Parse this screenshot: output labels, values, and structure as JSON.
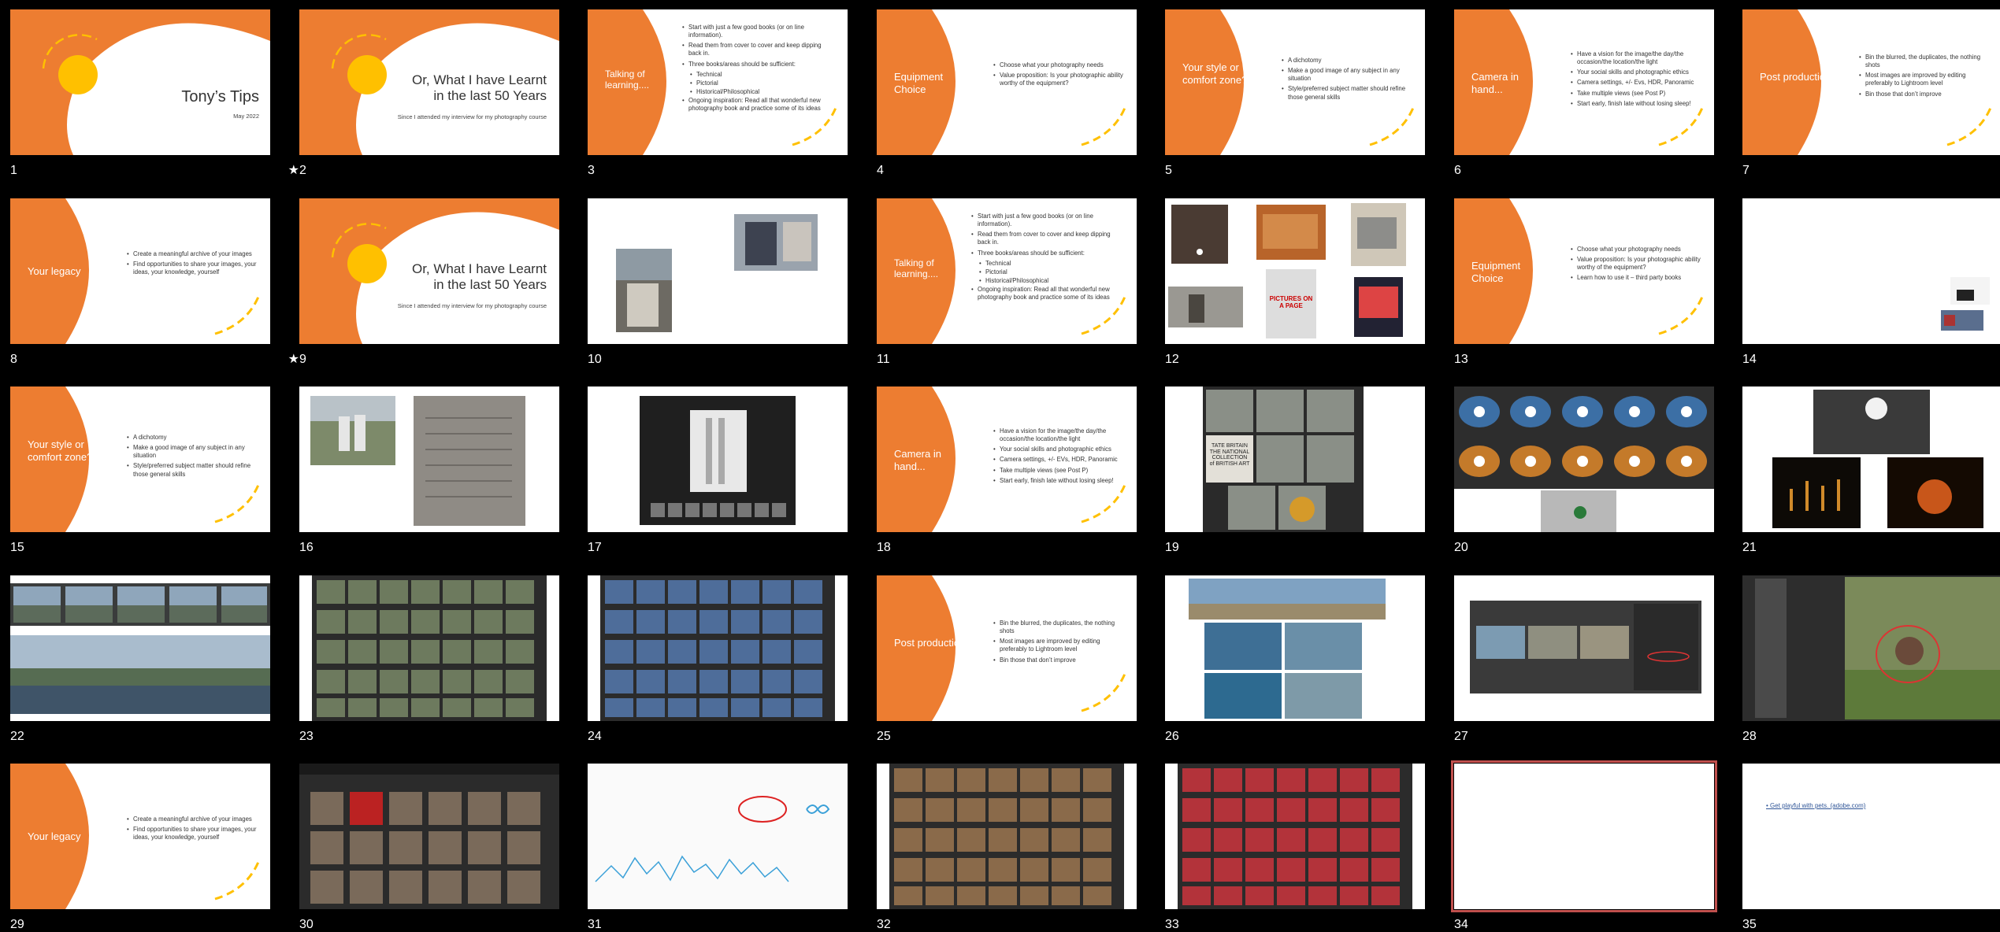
{
  "colors": {
    "orange": "#ed7d31",
    "sun": "#ffc000",
    "selection": "#c0504d"
  },
  "slides": {
    "s1": {
      "number": "1",
      "title": "Tony’s Tips",
      "subtitle": "May 2022"
    },
    "s2": {
      "number": "2",
      "title_line1": "Or, What I have Learnt",
      "title_line2": "in the last 50 Years",
      "subtitle": "Since I attended my interview for my photography course",
      "badge": "★"
    },
    "s3": {
      "number": "3",
      "bullets": [
        "Start with just a few good books (or on line information).",
        "Read them from cover to cover and keep dipping back in.",
        "Three books/areas should be sufficient:"
      ],
      "subbullets": [
        "Technical",
        "Pictorial",
        "Historical/Philosophical"
      ],
      "last": "Ongoing inspiration: Read all that wonderful new photography book and practice some of its ideas",
      "heading": "Talking of learning...."
    },
    "s4": {
      "number": "4",
      "heading": "Equipment Choice",
      "bullets": [
        "Choose what your photography needs",
        "Value proposition: Is your photographic ability worthy of the equipment?"
      ]
    },
    "s5": {
      "number": "5",
      "heading": "Your style or comfort zone?",
      "bullets": [
        "A dichotomy",
        "Make a good image of any subject in any situation",
        "Style/preferred subject matter should refine those general skills"
      ]
    },
    "s6": {
      "number": "6",
      "heading": "Camera in hand...",
      "bullets": [
        "Have a vision for the image/the day/the occasion/the location/the light",
        "Your social skills and photographic ethics",
        "Camera settings, +/- Evs, HDR, Panoramic",
        "Take multiple views (see Post P)",
        "Start early, finish late without losing sleep!"
      ]
    },
    "s7": {
      "number": "7",
      "heading": "Post production",
      "bullets": [
        "Bin the blurred, the duplicates, the nothing shots",
        "Most images are improved by editing preferably to Lightroom level",
        "Bin those that don’t improve"
      ]
    },
    "s8": {
      "number": "8",
      "heading": "Your legacy",
      "bullets": [
        "Create a meaningful archive of your images",
        "Find opportunities to share your images, your ideas, your knowledge, yourself"
      ]
    },
    "s9": {
      "number": "9",
      "title_line1": "Or, What I have Learnt",
      "title_line2": "in the last 50 Years",
      "subtitle": "Since I attended my interview for my photography course",
      "badge": "★"
    },
    "s10": {
      "number": "10"
    },
    "s11": {
      "number": "11",
      "heading": "Talking of learning....",
      "bullets": [
        "Start with just a few good books (or on line information).",
        "Read them from cover to cover and keep dipping back in.",
        "Three books/areas should be sufficient:"
      ],
      "subbullets": [
        "Technical",
        "Pictorial",
        "Historical/Philosophical"
      ],
      "last": "Ongoing inspiration: Read all that wonderful new photography book and practice some of its ideas"
    },
    "s12": {
      "number": "12",
      "book_text": "PICTURES ON A PAGE"
    },
    "s13": {
      "number": "13",
      "heading": "Equipment Choice",
      "bullets": [
        "Choose what your photography needs",
        "Value proposition: Is your photographic ability worthy of the equipment?",
        "Learn how to use it – third party books"
      ]
    },
    "s14": {
      "number": "14"
    },
    "s15": {
      "number": "15",
      "heading": "Your style or comfort zone?",
      "bullets": [
        "A dichotomy",
        "Make a good image of any subject in any situation",
        "Style/preferred subject matter should refine those general skills"
      ]
    },
    "s16": {
      "number": "16"
    },
    "s17": {
      "number": "17"
    },
    "s18": {
      "number": "18",
      "heading": "Camera in hand...",
      "bullets": [
        "Have a vision for the image/the day/the occasion/the location/the light",
        "Your social skills and photographic ethics",
        "Camera settings, +/- EVs, HDR, Panoramic",
        "Take multiple views (see Post P)",
        "Start early, finish late without losing sleep!"
      ]
    },
    "s19": {
      "number": "19",
      "sign_text": "TATE BRITAIN THE NATIONAL COLLECTION of BRITISH ART"
    },
    "s20": {
      "number": "20"
    },
    "s21": {
      "number": "21"
    },
    "s22": {
      "number": "22"
    },
    "s23": {
      "number": "23"
    },
    "s24": {
      "number": "24"
    },
    "s25": {
      "number": "25",
      "heading": "Post production",
      "bullets": [
        "Bin the blurred, the duplicates, the nothing shots",
        "Most images are improved by editing preferably to Lightroom level",
        "Bin those that don’t improve"
      ]
    },
    "s26": {
      "number": "26"
    },
    "s27": {
      "number": "27"
    },
    "s28": {
      "number": "28"
    },
    "s29": {
      "number": "29",
      "heading": "Your legacy",
      "bullets": [
        "Create a meaningful archive of your images",
        "Find opportunities to share your images, your ideas, your knowledge, yourself"
      ]
    },
    "s30": {
      "number": "30"
    },
    "s31": {
      "number": "31"
    },
    "s32": {
      "number": "32"
    },
    "s33": {
      "number": "33"
    },
    "s34": {
      "number": "34"
    },
    "s35": {
      "number": "35",
      "link": "Get playful with pets. (adobe.com)"
    }
  }
}
